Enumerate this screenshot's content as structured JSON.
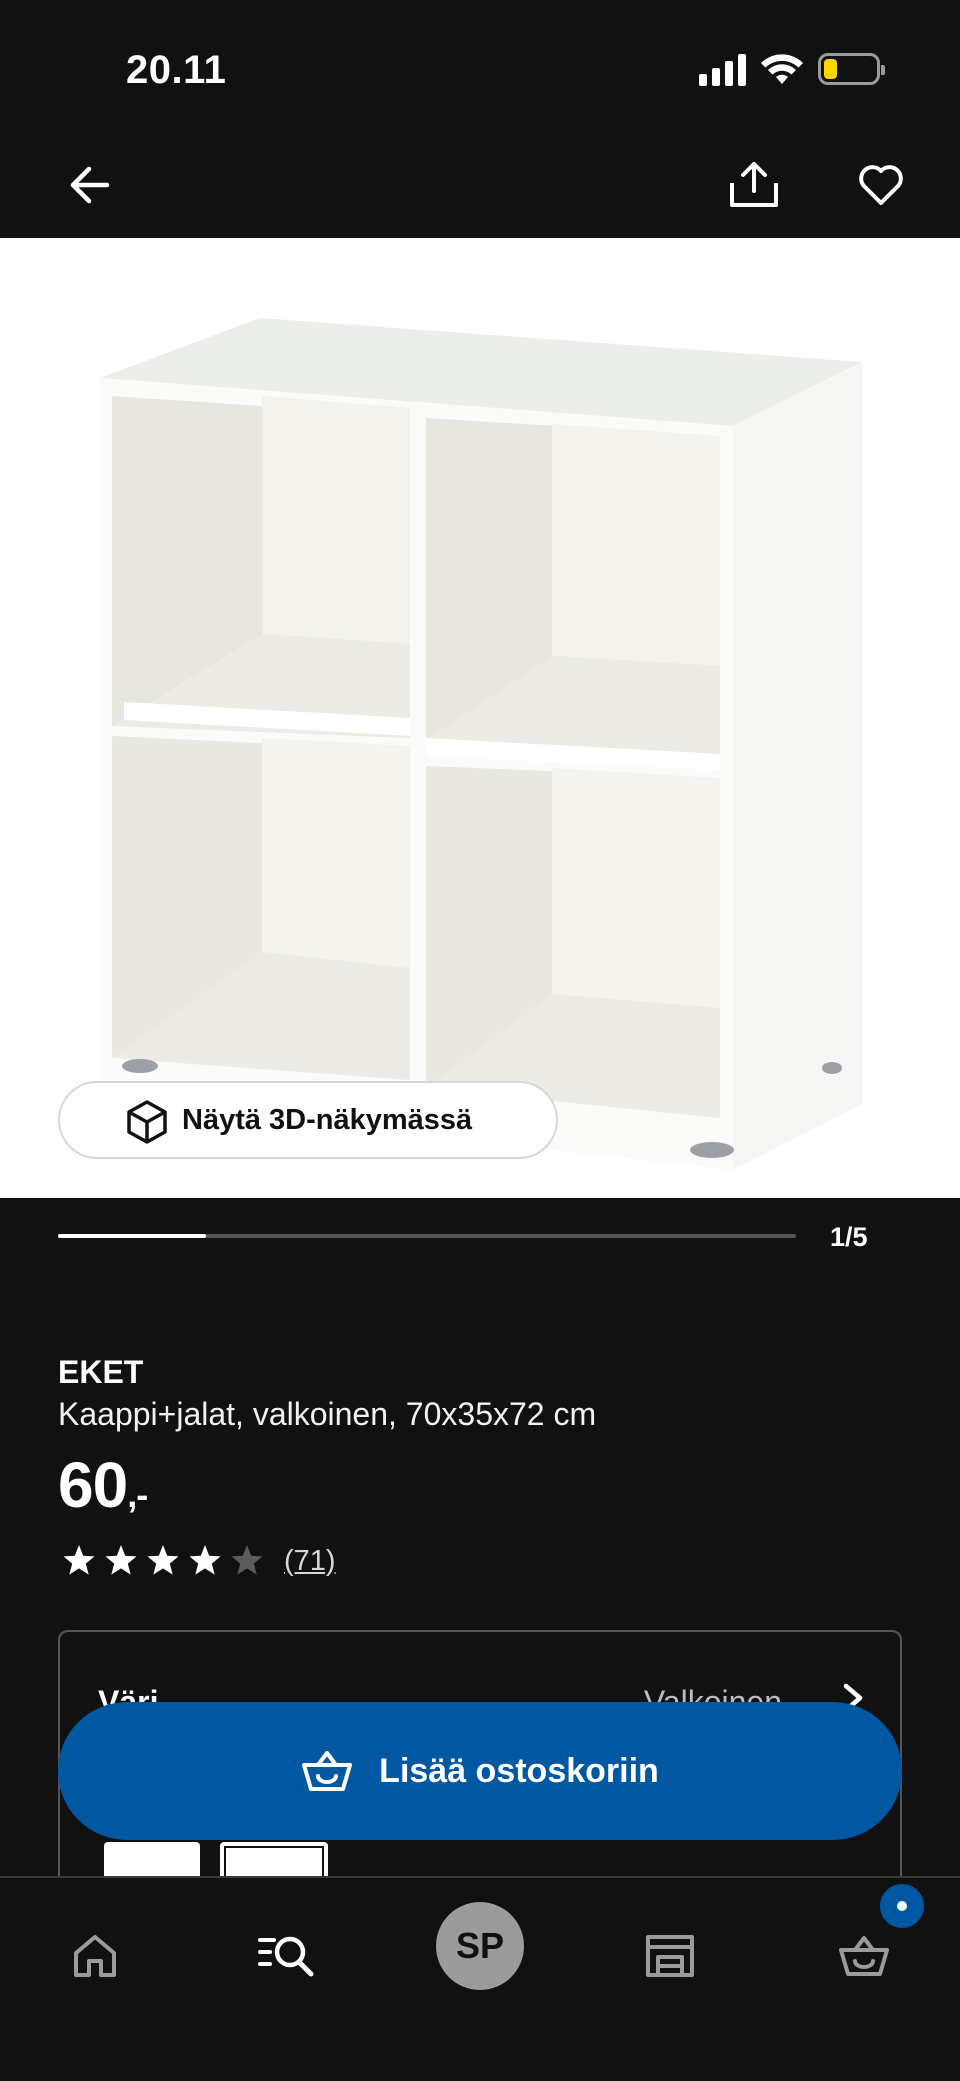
{
  "status_bar": {
    "time": "20.11",
    "icons": [
      "signal-icon",
      "wifi-icon",
      "battery-icon"
    ]
  },
  "top_bar": {
    "icons": [
      "back-arrow-icon",
      "share-icon",
      "heart-icon"
    ]
  },
  "hero": {
    "view_3d_label": "Näytä 3D-näkymässä",
    "gallery_counter": "1/5",
    "gallery_progress": 0.2
  },
  "product": {
    "name": "EKET",
    "description": "Kaappi+jalat, valkoinen, 70x35x72 cm",
    "price": "60",
    "price_suffix": ",-",
    "rating": 4,
    "rating_max": 5,
    "review_count": "(71)"
  },
  "variant": {
    "label": "Väri",
    "value": "Valkoinen"
  },
  "cart_button": {
    "label": "Lisää ostoskoriin"
  },
  "bottom_nav": {
    "profile_initials": "SP",
    "items": [
      "home-icon",
      "search-icon",
      "profile-avatar",
      "store-icon",
      "cart-icon"
    ]
  },
  "colors": {
    "background": "#111111",
    "accent": "#0058a3",
    "text": "#ffffff"
  }
}
